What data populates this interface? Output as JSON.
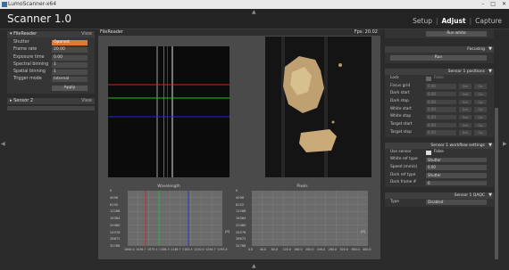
{
  "window": {
    "title": "LumoScanner-x64",
    "controls": [
      "–",
      "□",
      "✕"
    ]
  },
  "app": {
    "title": "Scanner 1.0"
  },
  "nav": {
    "setup": "Setup",
    "sep1": "|",
    "adjust": "Adjust",
    "sep2": "|",
    "capture": "Capture"
  },
  "arrows": {
    "up": "▲",
    "down": "▼",
    "left": "◀",
    "right": "▶"
  },
  "left_panel": {
    "header": "FileReader",
    "view": "View",
    "rows": [
      {
        "label": "Shutter",
        "value": "Opened"
      },
      {
        "label": "Frame rate",
        "value": "20.00"
      },
      {
        "label": "Exposure time",
        "value": "0.00"
      },
      {
        "label": "Spectral binning",
        "value": "1"
      },
      {
        "label": "Spatial binning",
        "value": "1"
      },
      {
        "label": "Trigger mode",
        "value": "Internal"
      }
    ],
    "apply": "Apply",
    "sensor2": {
      "header": "Sensor 2",
      "view": "View"
    }
  },
  "center": {
    "title": "FileReader",
    "fps": "Fps: 20.02",
    "graph1": {
      "title": "Wavelength",
      "ylabels": [
        "0",
        "4096",
        "8192",
        "12288",
        "16384",
        "20480",
        "24576",
        "28672",
        "32768"
      ],
      "xlabels": [
        "1000.0",
        "1036.7",
        "1073.4",
        "1108.3",
        "1146.7",
        "1183.4",
        "1220.0",
        "1256.7",
        "1293.4"
      ],
      "px": "[R]"
    },
    "graph2": {
      "title": "Pixels",
      "ylabels": [
        "0",
        "4096",
        "8192",
        "12288",
        "16384",
        "20480",
        "24576",
        "28672",
        "32768"
      ],
      "xlabels": [
        "0.0",
        "40.0",
        "80.0",
        "120.0",
        "160.0",
        "200.0",
        "240.0",
        "280.0",
        "320.0",
        "360.0",
        "400.0"
      ],
      "px": "[R]"
    }
  },
  "right_panel": {
    "top_btn": "Run white",
    "focusing": {
      "header": "Focusing",
      "run": "Run"
    },
    "positions": {
      "header": "Sensor 1 positions",
      "lock": {
        "label": "Lock",
        "value": "False"
      },
      "rows": [
        {
          "label": "Focus grid",
          "value": "0.00",
          "a": "Set",
          "b": "Go"
        },
        {
          "label": "Dark start",
          "value": "0.00",
          "a": "Set",
          "b": "Go"
        },
        {
          "label": "Dark stop",
          "value": "0.00",
          "a": "Set",
          "b": "Go"
        },
        {
          "label": "White start",
          "value": "0.00",
          "a": "Set",
          "b": "Go"
        },
        {
          "label": "White stop",
          "value": "0.00",
          "a": "Set",
          "b": "Go"
        },
        {
          "label": "Target start",
          "value": "0.00",
          "a": "Set",
          "b": "Go"
        },
        {
          "label": "Target stop",
          "value": "0.00",
          "a": "Set",
          "b": "Go"
        }
      ]
    },
    "workflow": {
      "header": "Sensor 1 workflow settings",
      "rows": [
        {
          "label": "Use sensor",
          "value": "False",
          "kind": "check"
        },
        {
          "label": "White ref type",
          "value": "Shutter",
          "kind": "select"
        },
        {
          "label": "Speed (mm/s)",
          "value": "0.00",
          "kind": "select"
        },
        {
          "label": "Dark ref type",
          "value": "Shutter",
          "kind": "select"
        },
        {
          "label": "Dark frame #",
          "value": "0",
          "kind": "select"
        }
      ]
    },
    "qaqc": {
      "header": "Sensor 1 QAQC",
      "type_label": "Type",
      "type_value": "Disabled"
    }
  },
  "chart_data": [
    {
      "type": "line",
      "title": "Wavelength",
      "xlabel": "",
      "ylabel": "",
      "ylim": [
        0,
        32768
      ],
      "xlim": [
        1000.0,
        1330.0
      ],
      "series": []
    },
    {
      "type": "line",
      "title": "Pixels",
      "xlabel": "",
      "ylabel": "",
      "ylim": [
        0,
        32768
      ],
      "xlim": [
        0,
        400
      ],
      "series": []
    }
  ]
}
